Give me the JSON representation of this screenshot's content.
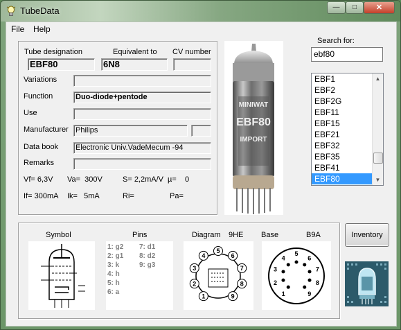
{
  "window": {
    "title": "TubeData",
    "minimize": "—",
    "maximize": "□",
    "close": "✕"
  },
  "menu": {
    "file": "File",
    "help": "Help"
  },
  "fields": {
    "tube_designation_label": "Tube designation",
    "tube_designation": "EBF80",
    "equivalent_label": "Equivalent to",
    "equivalent": "6N8",
    "cv_label": "CV number",
    "cv": "",
    "variations_label": "Variations",
    "variations": "",
    "function_label": "Function",
    "function": "Duo-diode+pentode",
    "use_label": "Use",
    "use": "",
    "manufacturer_label": "Manufacturer",
    "manufacturer": "Philips",
    "manufacturer_extra": "",
    "databook_label": "Data book",
    "databook": "Electronic Univ.VadeMecum -94",
    "remarks_label": "Remarks",
    "remarks": ""
  },
  "specs": {
    "vf": "Vf= 6,3V",
    "va": "Va=  300V",
    "s": "S= 2,2mA/V",
    "mu": "µ=    0",
    "if": "If= 300mA",
    "ik": "Ik=   5mA",
    "ri": "Ri=",
    "pa": "Pa="
  },
  "search": {
    "label": "Search for:",
    "value": "ebf80"
  },
  "tube_list": {
    "items": [
      "EBF1",
      "EBF2",
      "EBF2G",
      "EBF11",
      "EBF15",
      "EBF21",
      "EBF32",
      "EBF35",
      "EBF41",
      "EBF80"
    ],
    "selected": "EBF80"
  },
  "bottom": {
    "symbol_label": "Symbol",
    "pins_label": "Pins",
    "diagram_label": "Diagram",
    "diagram_code": "9HE",
    "base_label": "Base",
    "base_code": "B9A",
    "pins_col1": [
      "1: g2",
      "2: g1",
      "3: k",
      "4: h",
      "5: h",
      "6: a"
    ],
    "pins_col2": [
      "7: d1",
      "8: d2",
      "9: g3"
    ],
    "diagram_pins": [
      "1",
      "2",
      "3",
      "4",
      "5",
      "6",
      "7",
      "8",
      "9"
    ],
    "base_pins": [
      "1",
      "2",
      "3",
      "4",
      "5",
      "6",
      "7",
      "8",
      "9"
    ]
  },
  "inventory_button": "Inventory",
  "tube_photo": {
    "brand_lines": [
      "MINIWAT",
      "EBF80",
      "IMPORT"
    ]
  },
  "colors": {
    "selection": "#3399ff",
    "window_frame": "#6b9668"
  },
  "icons": [
    "lightbulb-icon",
    "tube-photo",
    "tube-symbol",
    "pin-diagram",
    "base-diagram",
    "app-logo-icon"
  ]
}
